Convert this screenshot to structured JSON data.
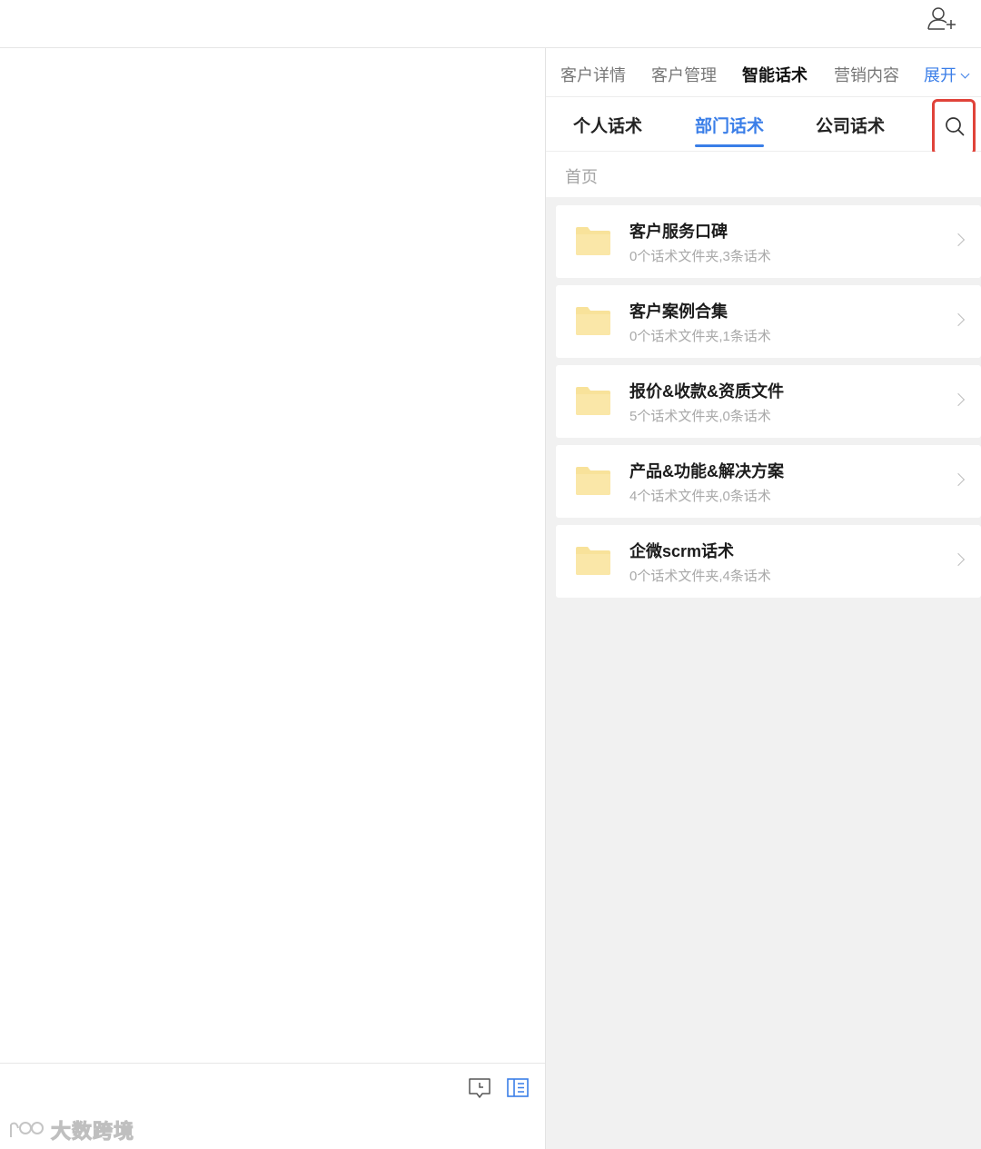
{
  "main_tabs": [
    {
      "label": "客户详情",
      "active": false
    },
    {
      "label": "客户管理",
      "active": false
    },
    {
      "label": "智能话术",
      "active": true
    },
    {
      "label": "营销内容",
      "active": false
    },
    {
      "label": "展开",
      "active": false
    }
  ],
  "sub_tabs": [
    {
      "label": "个人话术",
      "active": false
    },
    {
      "label": "部门话术",
      "active": true
    },
    {
      "label": "公司话术",
      "active": false
    }
  ],
  "breadcrumb": "首页",
  "folders": [
    {
      "name": "客户服务口碑",
      "meta": "0个话术文件夹,3条话术"
    },
    {
      "name": "客户案例合集",
      "meta": "0个话术文件夹,1条话术"
    },
    {
      "name": "报价&收款&资质文件",
      "meta": "5个话术文件夹,0条话术"
    },
    {
      "name": "产品&功能&解决方案",
      "meta": "4个话术文件夹,0条话术"
    },
    {
      "name": "企微scrm话术",
      "meta": "0个话术文件夹,4条话术"
    }
  ],
  "watermark": "大数跨境",
  "icons": {
    "top_right": "add-contact-icon",
    "search": "search-icon",
    "folder": "folder-icon",
    "footer_left": "chat-history-icon",
    "footer_right": "side-panel-icon"
  },
  "colors": {
    "accent": "#3a7ee8",
    "highlight_box": "#e0433a",
    "folder": "#f8e29a"
  }
}
